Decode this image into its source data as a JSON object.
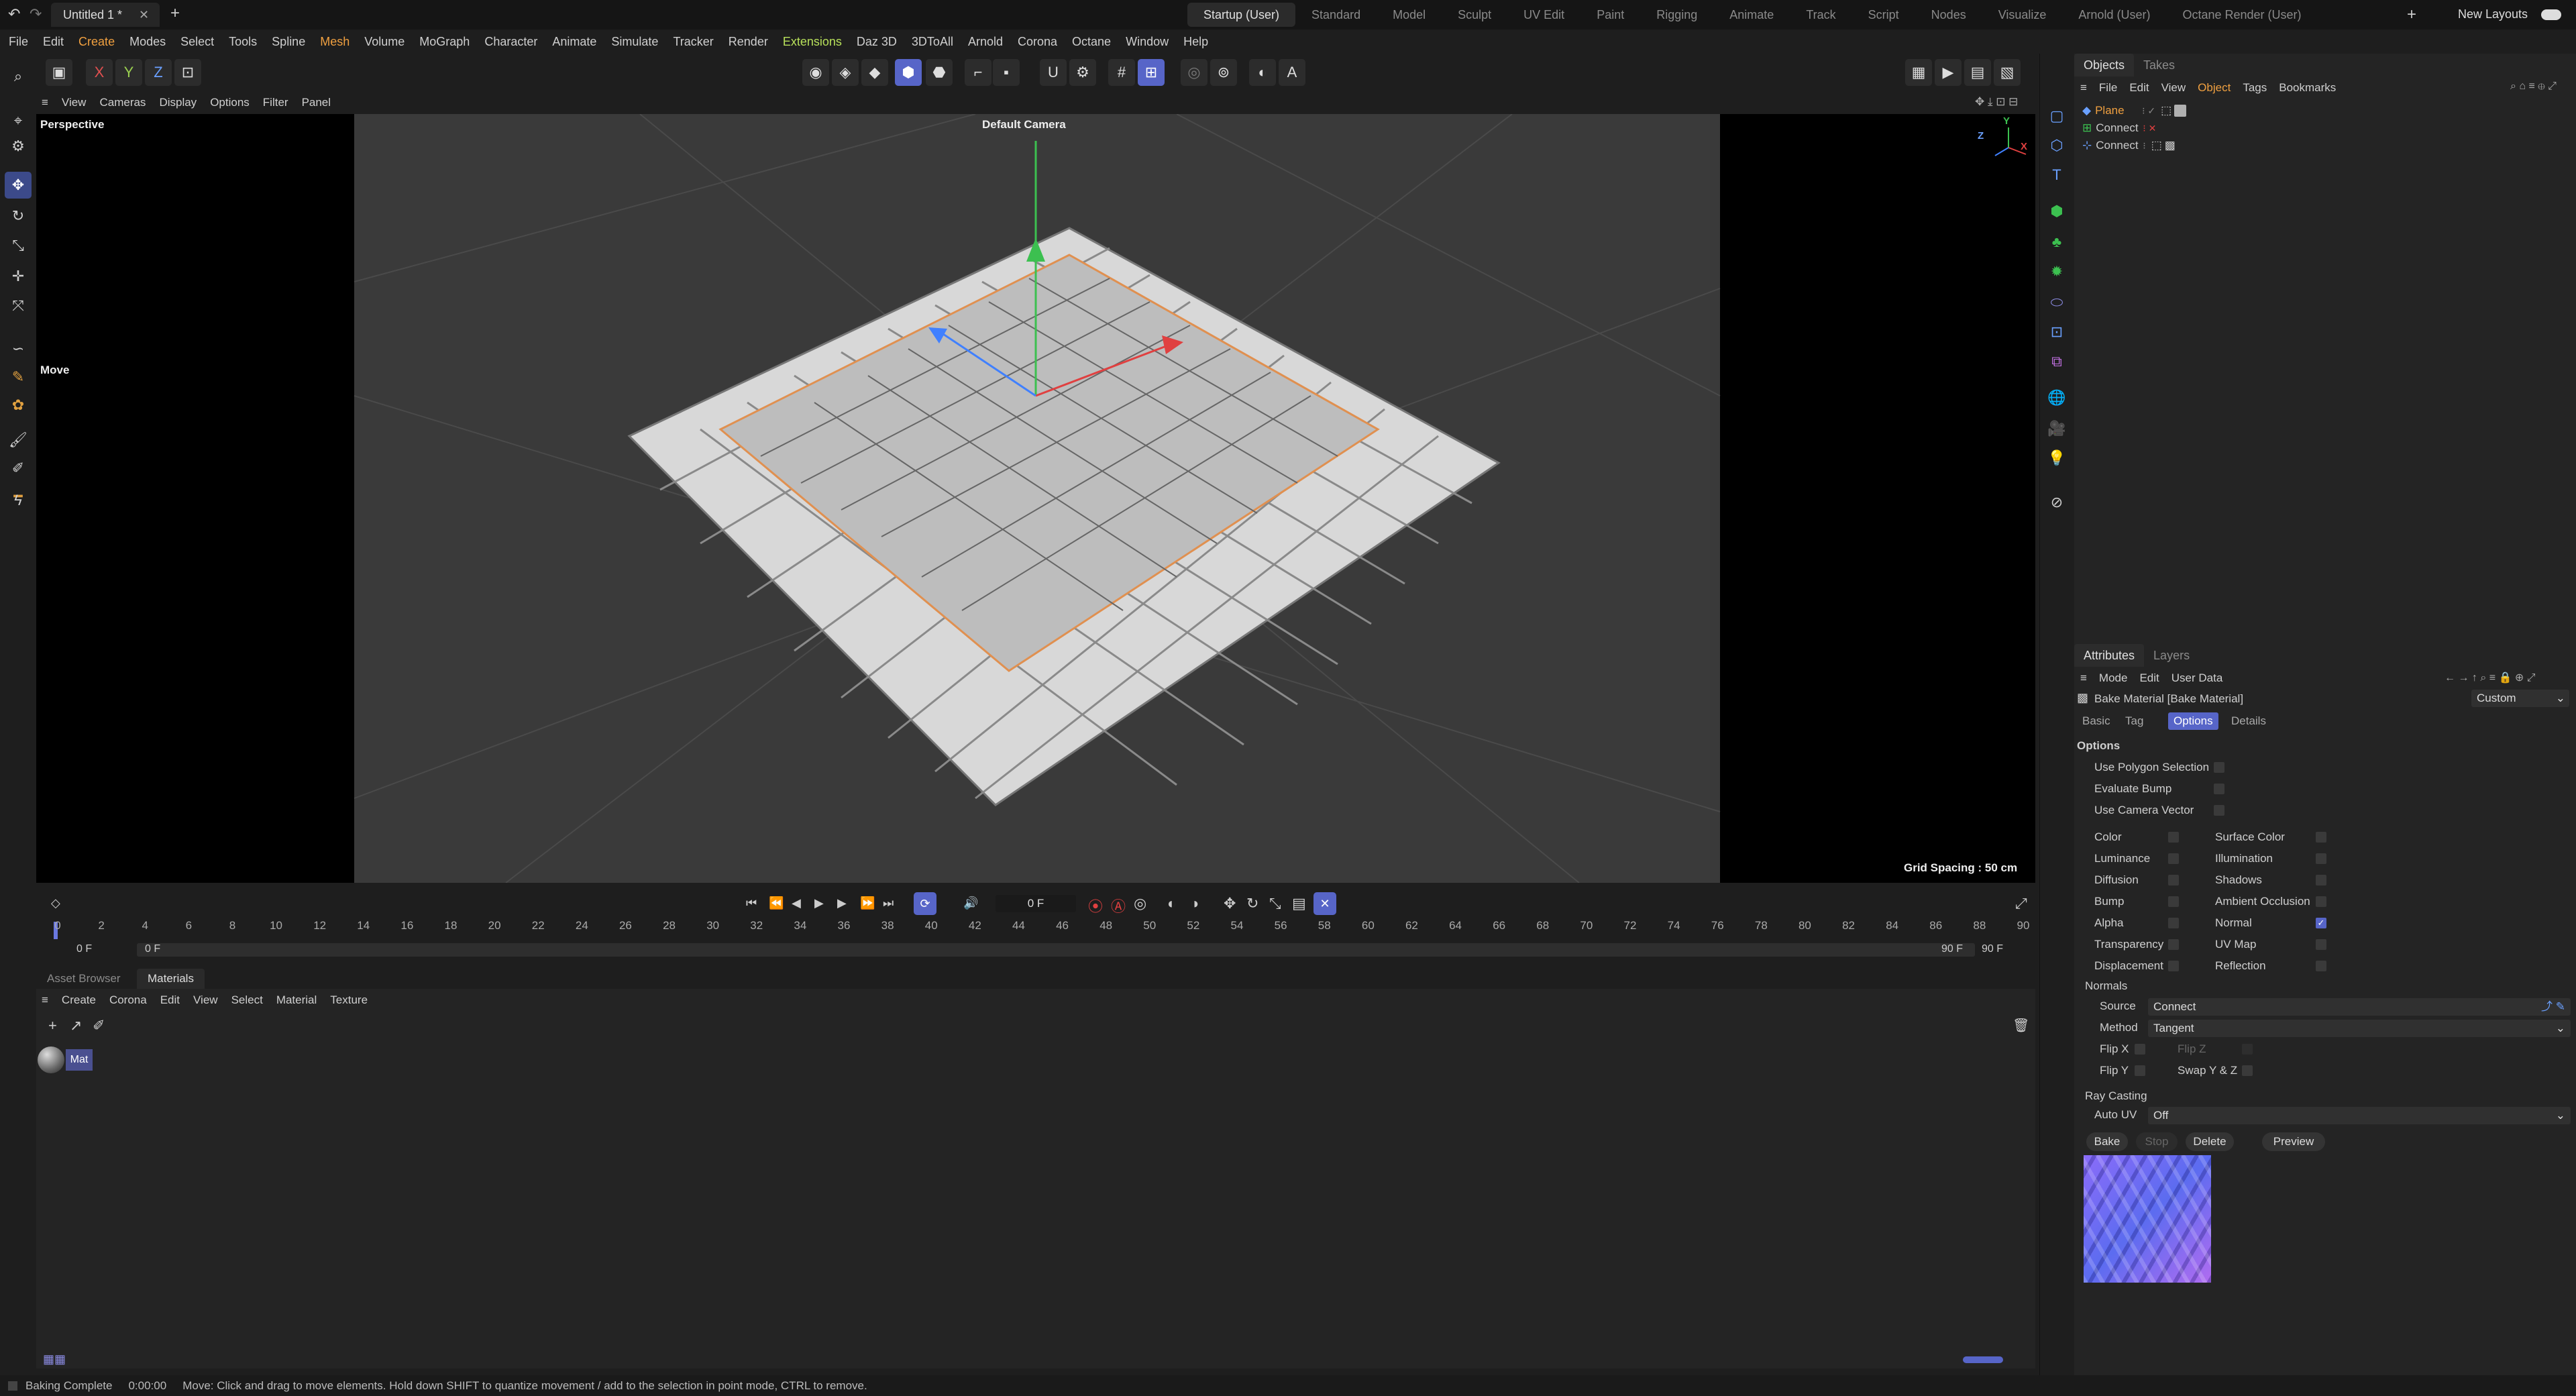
{
  "title_tab": "Untitled 1 *",
  "layouts": [
    "Startup (User)",
    "Standard",
    "Model",
    "Sculpt",
    "UV Edit",
    "Paint",
    "Rigging",
    "Animate",
    "Track",
    "Script",
    "Nodes",
    "Visualize",
    "Arnold (User)",
    "Octane Render (User)"
  ],
  "new_layouts": "New Layouts",
  "menu": [
    "File",
    "Edit",
    "Create",
    "Modes",
    "Select",
    "Tools",
    "Spline",
    "Mesh",
    "Volume",
    "MoGraph",
    "Character",
    "Animate",
    "Simulate",
    "Tracker",
    "Render",
    "Extensions",
    "Daz 3D",
    "3DToAll",
    "Arnold",
    "Corona",
    "Octane",
    "Window",
    "Help"
  ],
  "toolbar_axes": [
    "X",
    "Y",
    "Z"
  ],
  "viewport": {
    "menu": [
      "View",
      "Cameras",
      "Display",
      "Options",
      "Filter",
      "Panel"
    ],
    "name": "Perspective",
    "camera": "Default Camera",
    "tool": "Move",
    "grid_spacing": "Grid Spacing : 50 cm",
    "axis_labels": [
      "Z",
      "Y",
      "X"
    ]
  },
  "timeline": {
    "frame_field": "0 F",
    "ticks": [
      "0",
      "2",
      "4",
      "6",
      "8",
      "10",
      "12",
      "14",
      "16",
      "18",
      "20",
      "22",
      "24",
      "26",
      "28",
      "30",
      "32",
      "34",
      "36",
      "38",
      "40",
      "42",
      "44",
      "46",
      "48",
      "50",
      "52",
      "54",
      "56",
      "58",
      "60",
      "62",
      "64",
      "66",
      "68",
      "70",
      "72",
      "74",
      "76",
      "78",
      "80",
      "82",
      "84",
      "86",
      "88",
      "90"
    ],
    "range_start": "0 F",
    "range_start2": "0 F",
    "range_end": "90 F",
    "range_end2": "90 F"
  },
  "materials": {
    "tabs": [
      "Asset Browser",
      "Materials"
    ],
    "menu": [
      "Create",
      "Corona",
      "Edit",
      "View",
      "Select",
      "Material",
      "Texture"
    ],
    "items": [
      {
        "name": "Mat"
      }
    ]
  },
  "objects": {
    "tabs": [
      "Objects",
      "Takes"
    ],
    "menu": [
      "File",
      "Edit",
      "View",
      "Object",
      "Tags",
      "Bookmarks"
    ],
    "rows": [
      {
        "name": "Plane",
        "selected": true
      },
      {
        "name": "Connect",
        "selected": false
      },
      {
        "name": "Connect",
        "selected": false
      }
    ]
  },
  "attributes": {
    "tabs": [
      "Attributes",
      "Layers"
    ],
    "menu": [
      "Mode",
      "Edit",
      "User Data"
    ],
    "header": "Bake Material [Bake Material]",
    "preset": "Custom",
    "subtabs": [
      "Basic",
      "Tag",
      "Options",
      "Details"
    ],
    "section": "Options",
    "top_opts": [
      "Use Polygon Selection",
      "Evaluate Bump",
      "Use Camera Vector"
    ],
    "left_opts": [
      "Color",
      "Luminance",
      "Diffusion",
      "Bump",
      "Alpha",
      "Transparency",
      "Displacement"
    ],
    "right_opts": [
      "Surface Color",
      "Illumination",
      "Shadows",
      "Ambient Occlusion",
      "Normal",
      "UV Map",
      "Reflection"
    ],
    "right_checked": [
      false,
      false,
      false,
      false,
      true,
      false,
      false
    ],
    "normals_header": "Normals",
    "source_label": "Source",
    "source_value": "Connect",
    "method_label": "Method",
    "method_value": "Tangent",
    "flip_x": "Flip X",
    "flip_z": "Flip Z",
    "flip_y": "Flip Y",
    "swap": "Swap Y & Z",
    "raycast_header": "Ray Casting",
    "autouv_label": "Auto UV",
    "autouv_value": "Off",
    "buttons": [
      "Bake",
      "Stop",
      "Delete",
      "Preview"
    ]
  },
  "status": {
    "state": "Baking Complete",
    "time": "0:00:00",
    "message": "Move: Click and drag to move elements. Hold down SHIFT to quantize movement / add to the selection in point mode, CTRL to remove."
  },
  "colors": {
    "accent": "#5765c8",
    "selection": "#f0a040",
    "bake_preview": "#7b6cf0"
  }
}
